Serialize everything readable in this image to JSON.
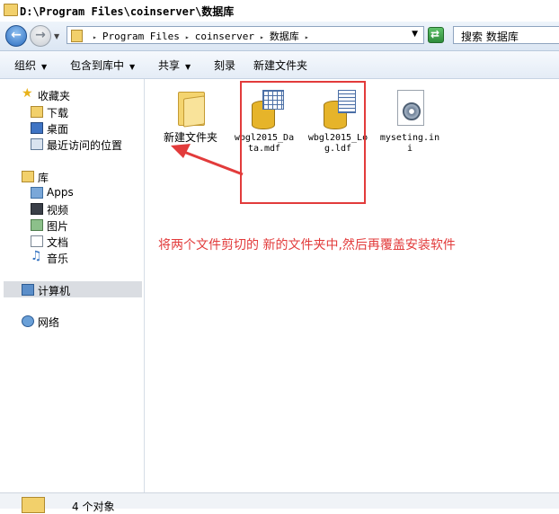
{
  "window": {
    "title": "D:\\Program Files\\coinserver\\数据库"
  },
  "address_bar": {
    "breadcrumbs": [
      "Program Files",
      "coinserver",
      "数据库"
    ],
    "search_placeholder": "搜索 数据库"
  },
  "toolbar": {
    "organize": "组织",
    "include_in_library": "包含到库中",
    "share": "共享",
    "burn": "刻录",
    "new_folder": "新建文件夹"
  },
  "sidebar": {
    "favorites": "收藏夹",
    "favorites_items": [
      "下载",
      "桌面",
      "最近访问的位置"
    ],
    "libraries": "库",
    "libraries_items": [
      "Apps",
      "视频",
      "图片",
      "文档",
      "音乐"
    ],
    "computer": "计算机",
    "network": "网络"
  },
  "files": [
    {
      "name": "新建文件夹",
      "type": "folder"
    },
    {
      "name": "wbgl2015_Data.mdf",
      "type": "database"
    },
    {
      "name": "wbgl2015_Log.ldf",
      "type": "database-log"
    },
    {
      "name": "myseting.ini",
      "type": "config"
    }
  ],
  "annotation": {
    "text": "将两个文件剪切的 新的文件夹中,然后再覆盖安装软件",
    "color": "#e23b3b"
  },
  "status": {
    "text": "4 个对象"
  },
  "colors": {
    "accent_red": "#e23b3b",
    "folder": "#f2d06b"
  }
}
